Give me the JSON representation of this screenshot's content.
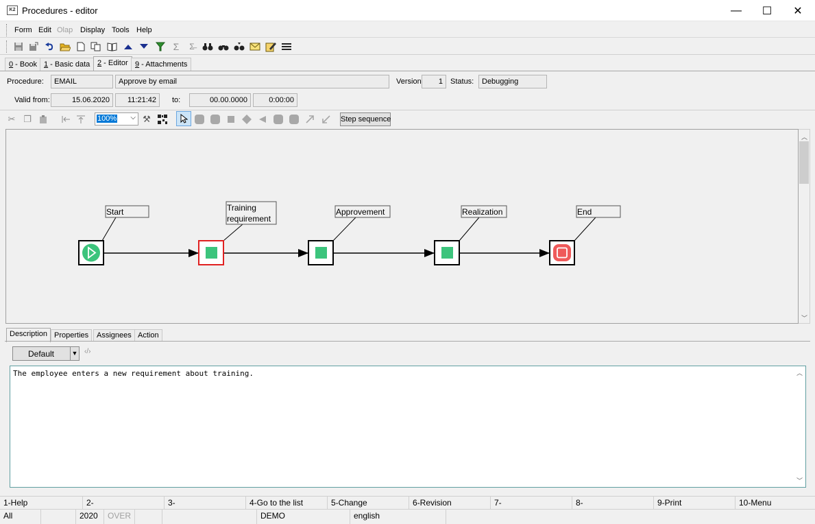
{
  "window": {
    "title": "Procedures - editor",
    "minimize": "—",
    "maximize": "☐",
    "close": "✕"
  },
  "menu": {
    "items": [
      {
        "label": "Form",
        "enabled": true
      },
      {
        "label": "Edit",
        "enabled": true
      },
      {
        "label": "Olap",
        "enabled": false
      },
      {
        "label": "Display",
        "enabled": true
      },
      {
        "label": "Tools",
        "enabled": true
      },
      {
        "label": "Help",
        "enabled": true
      }
    ]
  },
  "toolbar": {
    "icons": [
      "save-icon",
      "save-as-icon",
      "undo-icon",
      "open-folder-icon",
      "new-document-icon",
      "copy-record-icon",
      "book-icon",
      "arrow-up-icon",
      "arrow-down-icon",
      "filter-icon",
      "sum-icon",
      "subtotal-icon",
      "binoculars-icon",
      "find-next-icon",
      "find-prev-icon",
      "email-icon",
      "edit-icon",
      "menu-lines-icon"
    ]
  },
  "tabs": [
    {
      "key": "0",
      "label": " - Book",
      "active": false
    },
    {
      "key": "1",
      "label": " - Basic data",
      "active": false
    },
    {
      "key": "2",
      "label": " - Editor",
      "active": true
    },
    {
      "key": "9",
      "label": " - Attachments",
      "active": false
    }
  ],
  "form": {
    "procedure_label": "Procedure:",
    "procedure_code": "EMAIL",
    "procedure_name": "Approve by email",
    "version_label": "Version:",
    "version": "1",
    "status_label": "Status:",
    "status": "Debugging",
    "valid_from_label": "Valid from:",
    "valid_from_date": "15.06.2020",
    "valid_from_time": "11:21:42",
    "to_label": "to:",
    "to_date": "00.00.0000",
    "to_time": "0:00:00"
  },
  "editor_toolbar": {
    "zoom": "100%",
    "step_sequence_label": "Step sequence"
  },
  "diagram": {
    "nodes": [
      {
        "id": "start",
        "label": "Start",
        "type": "start",
        "selected": false
      },
      {
        "id": "training",
        "label_lines": [
          "Training",
          "requirement"
        ],
        "type": "step",
        "selected": true
      },
      {
        "id": "approvement",
        "label": "Approvement",
        "type": "step",
        "selected": false
      },
      {
        "id": "realization",
        "label": "Realization",
        "type": "step",
        "selected": false
      },
      {
        "id": "end",
        "label": "End",
        "type": "end",
        "selected": false
      }
    ],
    "colors": {
      "step_fill": "#3cc47c",
      "end_fill": "#ef5a5a",
      "selected_border": "#e02020"
    }
  },
  "subtabs": [
    {
      "label": "Description",
      "active": true
    },
    {
      "label": "Properties",
      "active": false
    },
    {
      "label": "Assignees",
      "active": false
    },
    {
      "label": "Action",
      "active": false
    }
  ],
  "description": {
    "style": "Default",
    "text": "The employee enters a new requirement about training."
  },
  "function_keys": [
    "1-Help",
    "2-",
    "3-",
    "4-Go to the list",
    "5-Change",
    "6-Revision",
    "7-",
    "8-",
    "9-Print",
    "10-Menu"
  ],
  "status_bar": {
    "scope": "All",
    "year": "2020",
    "mode": "OVER",
    "database": "DEMO",
    "language": "english"
  }
}
